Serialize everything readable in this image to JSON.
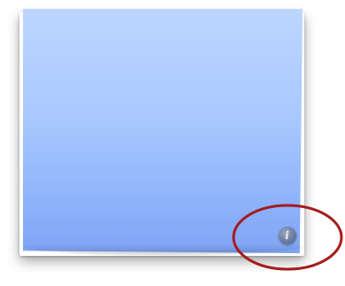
{
  "widget": {
    "info_glyph": "i",
    "info_icon_name": "info-icon",
    "note_color_top": "#bcd6ff",
    "note_color_bottom": "#7fa5f4"
  },
  "annotation": {
    "ellipse_color": "#a51c1c"
  }
}
